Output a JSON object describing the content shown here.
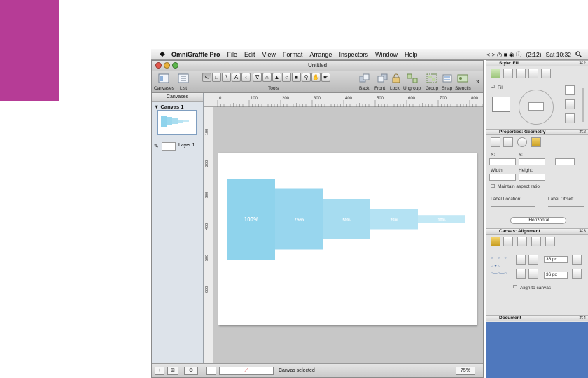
{
  "menubar": {
    "apple": "",
    "app_name": "OmniGraffle Pro",
    "items": [
      "File",
      "Edit",
      "View",
      "Format",
      "Arrange",
      "Inspectors",
      "Window",
      "Help"
    ],
    "status": {
      "icons": "< > ◷ ■ ◉ ⓘ",
      "battery": "(2:12)",
      "clock": "Sat 10:32",
      "search_icon": "magnifier"
    }
  },
  "window": {
    "title": "Untitled",
    "toolbar": {
      "canvases_label": "Canvases",
      "list_label": "List",
      "tools_label": "Tools",
      "back": "Back",
      "front": "Front",
      "lock": "Lock",
      "ungroup": "Ungroup",
      "group": "Group",
      "snap": "Snap",
      "stencils": "Stencils",
      "overflow": "»"
    },
    "sidebar": {
      "header": "Canvases",
      "canvas_name": "Canvas 1",
      "layer_name": "Layer 1"
    },
    "ruler_labels": [
      "0",
      "100",
      "200",
      "300",
      "400",
      "500",
      "600",
      "700",
      "800"
    ],
    "left_ruler_labels": [
      "100",
      "200",
      "300",
      "400",
      "500",
      "600"
    ],
    "status": {
      "text": "Canvas selected",
      "zoom": "75%"
    }
  },
  "diagram": {
    "fill_color": "#8fd3ec",
    "bars": [
      {
        "label": "100%",
        "value": 100
      },
      {
        "label": "75%",
        "value": 75
      },
      {
        "label": "50%",
        "value": 50
      },
      {
        "label": "25%",
        "value": 25
      },
      {
        "label": "10%",
        "value": 10
      }
    ]
  },
  "inspector": {
    "style_header": "Style: Fill",
    "fill_label": "Fill",
    "properties_header": "Properties: Geometry",
    "properties_shortcut": "⌘2",
    "style_shortcut": "⌘2",
    "x_label": "X:",
    "y_label": "Y:",
    "width_label": "Width:",
    "height_label": "Height:",
    "maintain_label": "Maintain aspect ratio",
    "label_location": "Label Location:",
    "label_offset": "Label Offset:",
    "orientation": "Horizontal",
    "alignment_header": "Canvas: Alignment",
    "alignment_shortcut": "⌘3",
    "spacing1": "36 px",
    "spacing2": "36 px",
    "align_to_canvas": "Align to canvas",
    "document_header": "Document",
    "document_shortcut": "⌘4"
  },
  "colors": {
    "magenta": "#b63c96",
    "desktop_blue": "#4f78bd"
  }
}
